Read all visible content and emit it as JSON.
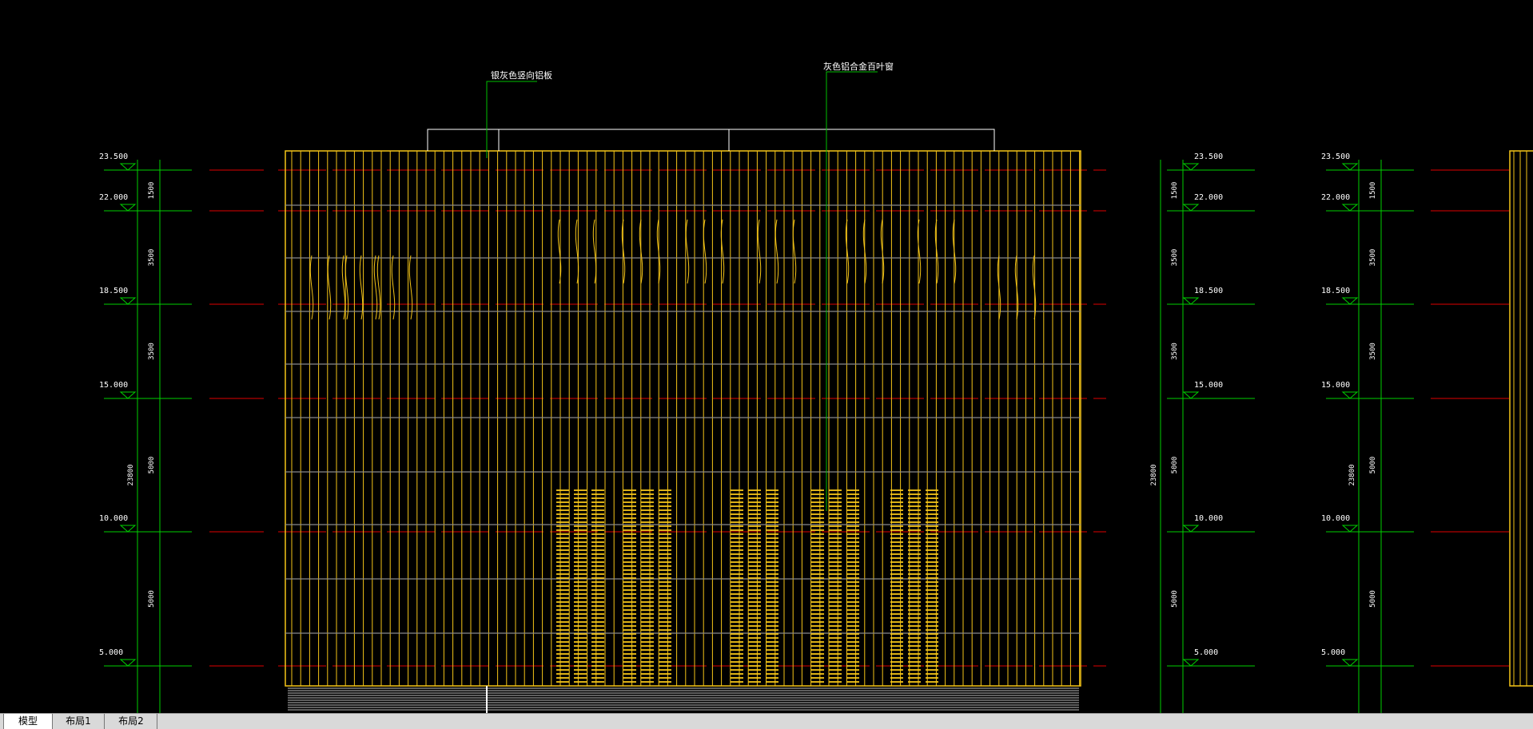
{
  "tabs": [
    "模型",
    "布局1",
    "布局2"
  ],
  "annotations": {
    "left": "银灰色竖向铝板",
    "right": "灰色铝合金百叶窗"
  },
  "elevations": [
    "23.500",
    "22.000",
    "18.500",
    "15.000",
    "10.000",
    "5.000"
  ],
  "story_dims": [
    "1500",
    "3500",
    "3500",
    "5000",
    "5000"
  ],
  "total_dim": "23800",
  "colors": {
    "background": "#000000",
    "facade": "#f5c518",
    "level_line": "#e00000",
    "dimension": "#00d000",
    "leader": "#00c000",
    "outline": "#ffffff"
  }
}
